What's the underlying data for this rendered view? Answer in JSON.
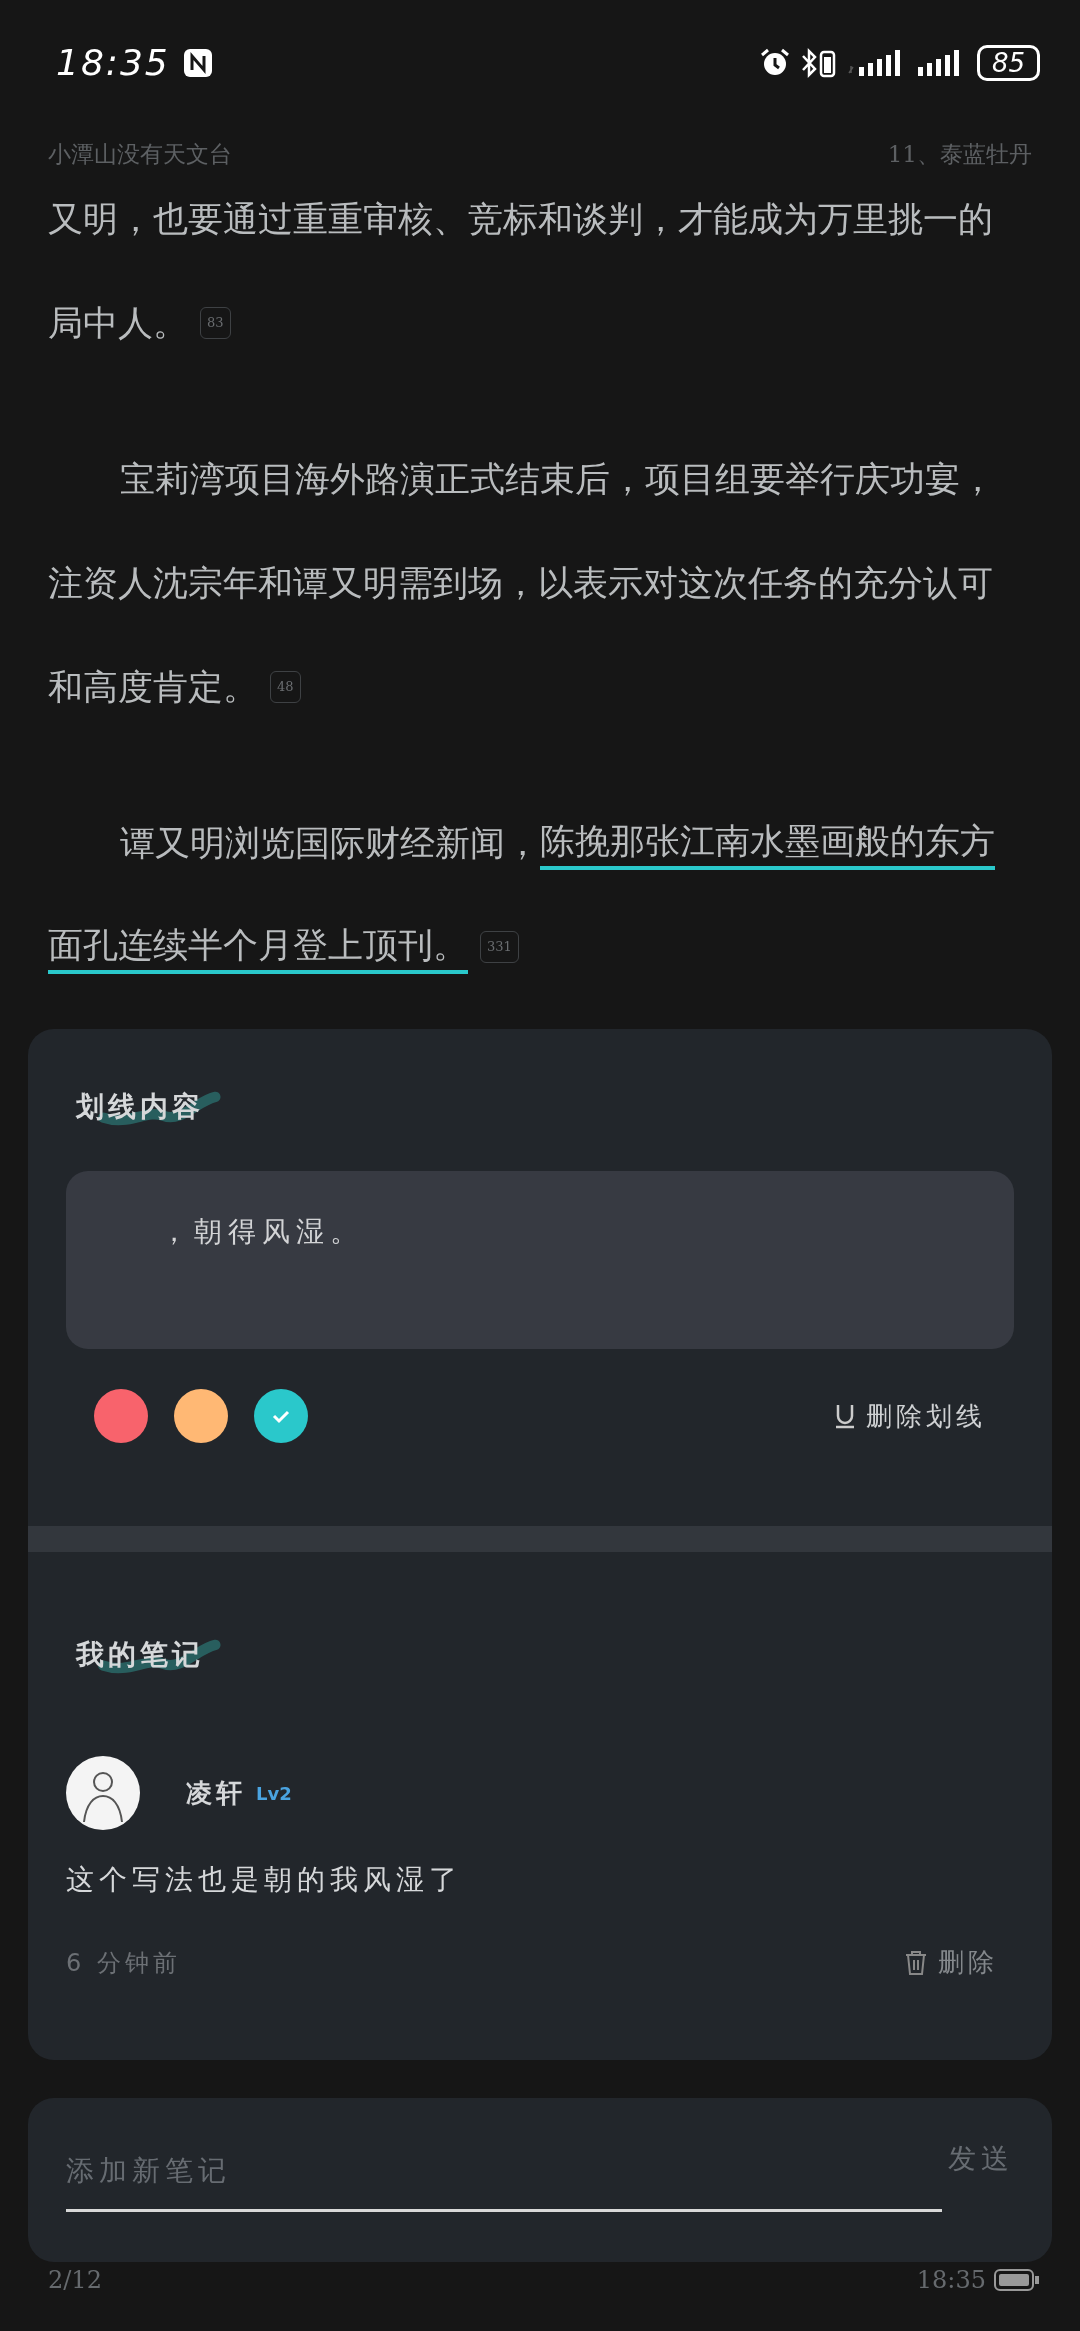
{
  "status_bar": {
    "time": "18:35",
    "battery": "85"
  },
  "header": {
    "book": "小潭山没有天文台",
    "chapter": "11、泰蓝牡丹"
  },
  "paragraphs": [
    {
      "indent": false,
      "badge": "83",
      "lines": [
        [
          {
            "text": "又明，也要通过重重审核、竞标和谈判，才能成为万里挑一的",
            "underlined": false
          }
        ],
        [
          {
            "text": "局中人。",
            "underlined": false
          }
        ]
      ]
    },
    {
      "indent": true,
      "badge": "48",
      "lines": [
        [
          {
            "text": "宝莉湾项目海外路演正式结束后，项目组要举行庆功宴，",
            "underlined": false
          }
        ],
        [
          {
            "text": "注资人沈宗年和谭又明需到场，以表示对这次任务的充分认可",
            "underlined": false
          }
        ],
        [
          {
            "text": "和高度肯定。",
            "underlined": false
          }
        ]
      ]
    },
    {
      "indent": true,
      "badge": "331",
      "lines": [
        [
          {
            "text": "谭又明浏览国际财经新闻，",
            "underlined": false
          },
          {
            "text": "陈挽那张江南水墨画般的东方",
            "underlined": true
          }
        ],
        [
          {
            "text": "面孔连续半个月登上顶刊。",
            "underlined": true
          }
        ]
      ]
    }
  ],
  "highlight_panel": {
    "title": "划线内容",
    "quote": "，朝得风湿。",
    "colors": [
      {
        "color": "#f8636c",
        "selected": false
      },
      {
        "color": "#ffb874",
        "selected": false
      },
      {
        "color": "#2ac8cb",
        "selected": true
      }
    ],
    "remove": "删除划线"
  },
  "notes": {
    "title": "我的笔记",
    "items": [
      {
        "user": "凌轩",
        "level": "Lv2",
        "text": "这个写法也是朝的我风湿了",
        "time": "6 分钟前",
        "delete": "删除"
      }
    ]
  },
  "composer": {
    "placeholder": "添加新笔记",
    "send": "发送"
  },
  "footer": {
    "page": "2/12",
    "time": "18:35"
  }
}
